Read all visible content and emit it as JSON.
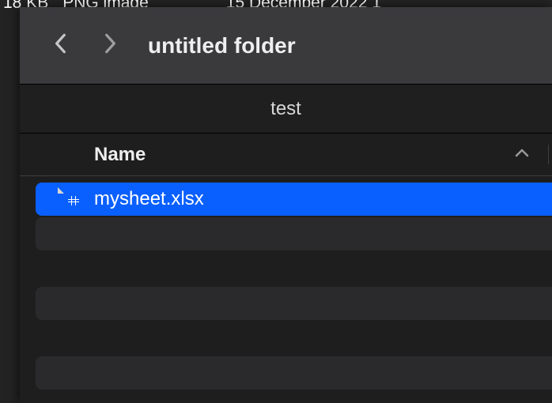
{
  "background": {
    "size": "18 KB",
    "type": "PNG image",
    "date": "15 December 2022 1"
  },
  "window": {
    "title": "untitled folder",
    "pathbar": "test",
    "columns": {
      "name": "Name"
    },
    "rows": [
      {
        "name": "mysheet.xlsx",
        "icon": "xlsx-icon",
        "selected": true
      }
    ]
  }
}
